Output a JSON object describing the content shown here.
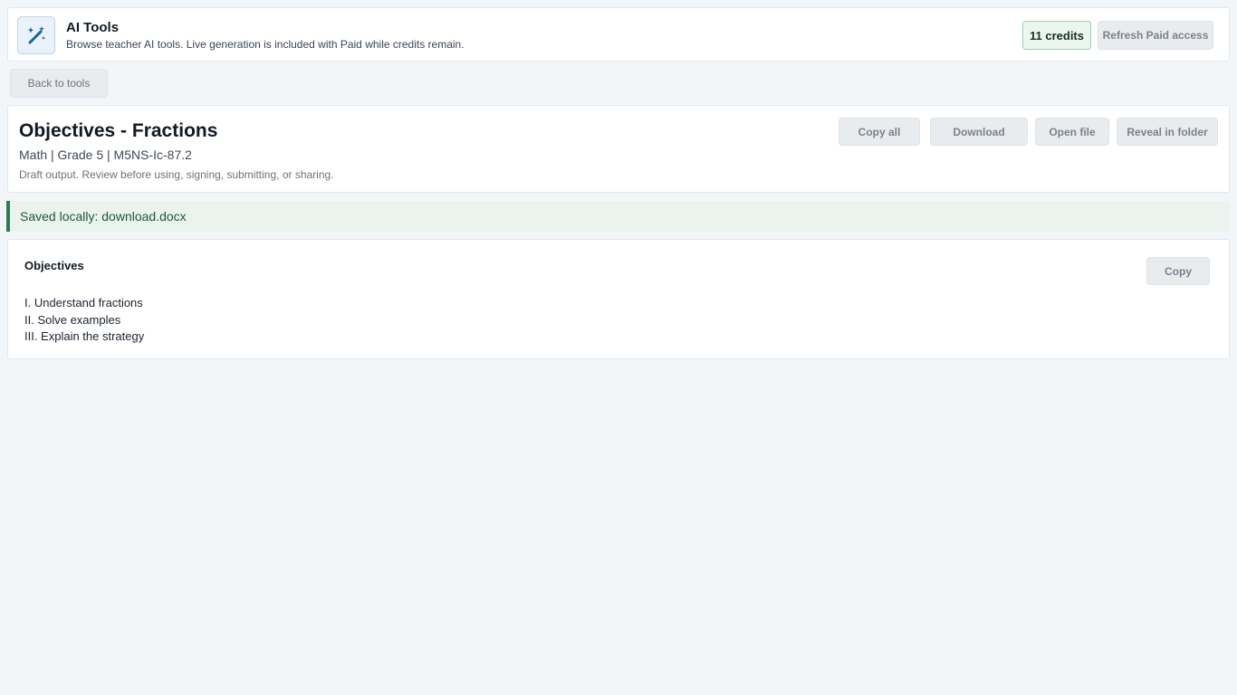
{
  "header": {
    "app_title": "AI Tools",
    "app_subtitle": "Browse teacher AI tools. Live generation is included with Paid while credits remain.",
    "app_icon": "magic-wand-icon",
    "credits": "11 credits",
    "refresh_label": "Refresh Paid access"
  },
  "nav": {
    "back_label": "Back to tools"
  },
  "document": {
    "title": "Objectives - Fractions",
    "meta": "Math | Grade 5 | M5NS-Ic-87.2",
    "note": "Draft output. Review before using, signing, submitting, or sharing.",
    "actions": {
      "copy_all": "Copy all",
      "download": "Download",
      "open_file": "Open file",
      "reveal": "Reveal in folder"
    }
  },
  "status": {
    "saved": "Saved locally: download.docx"
  },
  "output": {
    "title": "Objectives",
    "copy_label": "Copy",
    "lines": [
      "I. Understand fractions",
      "II. Solve examples",
      "III. Explain the strategy"
    ]
  },
  "colors": {
    "accent": "#1f5f96",
    "success": "#2d7a52",
    "background": "#f3f6f9"
  }
}
